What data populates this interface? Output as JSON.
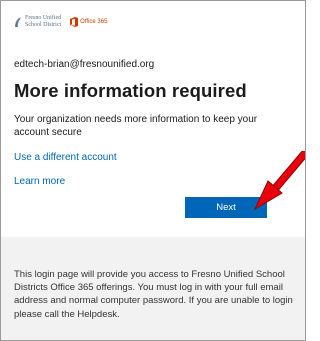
{
  "header": {
    "district_logo": {
      "line1": "Fresno Unified",
      "line2": "School District"
    },
    "office_logo_text": "Office 365"
  },
  "account": {
    "email": "edtech-brian@fresnounified.org"
  },
  "main": {
    "title": "More information required",
    "description": "Your organization needs more information to keep your account secure",
    "use_different_account_label": "Use a different account",
    "learn_more_label": "Learn more",
    "next_label": "Next"
  },
  "footer": {
    "text": "This login page will provide you access to Fresno Unified School Districts Office 365 offerings. You must log in with your full email address and normal computer password. If you are unable to login please call the Helpdesk."
  },
  "colors": {
    "accent": "#0067b8",
    "arrow": "#e8000b",
    "footer_bg": "#f2f2f2",
    "office_brand": "#d03b00"
  },
  "icons": {
    "district": "fresno-unified-logo-icon",
    "office": "office-365-logo-icon",
    "annotation": "red-arrow-icon"
  }
}
